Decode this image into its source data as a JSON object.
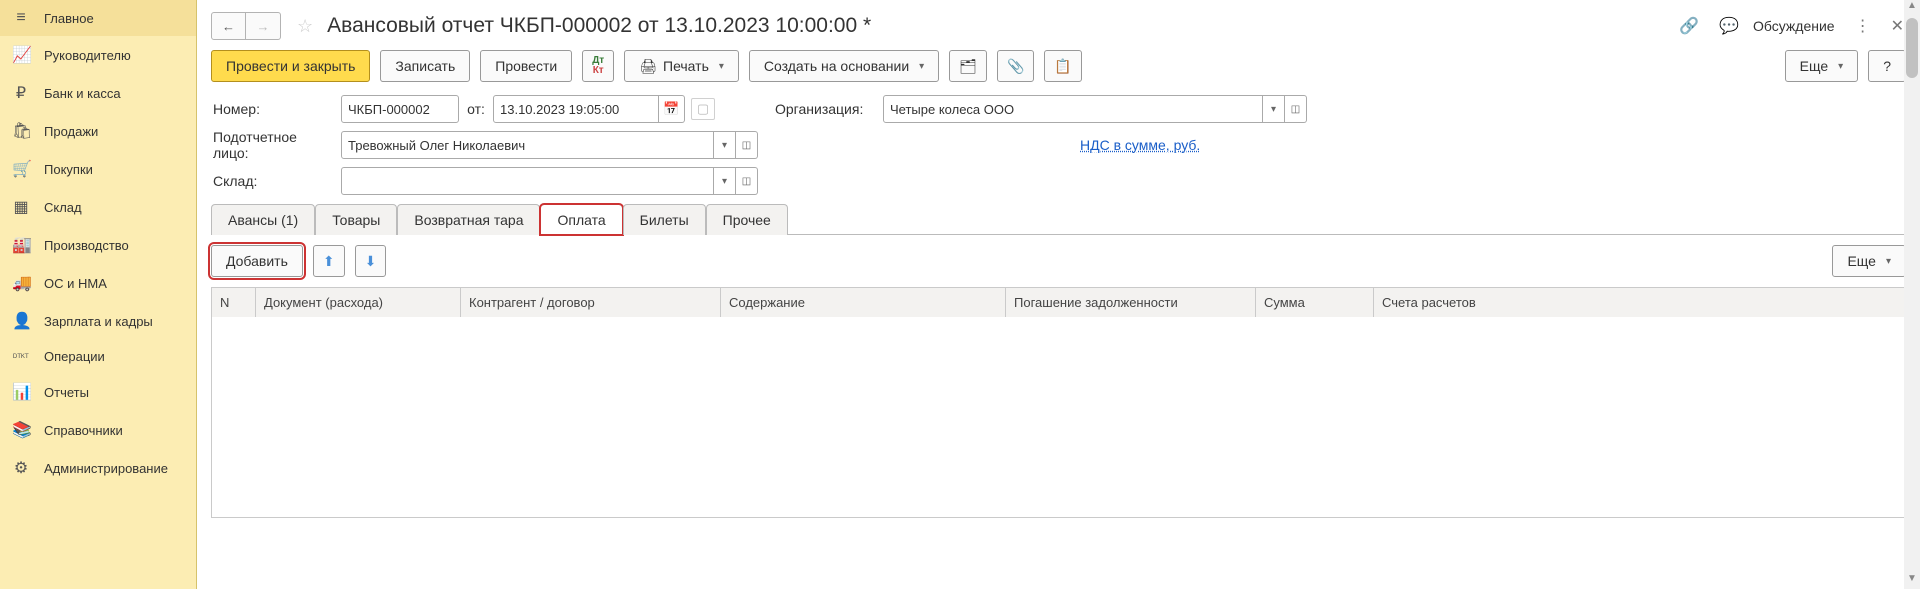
{
  "sidebar": {
    "items": [
      {
        "icon": "≡",
        "label": "Главное"
      },
      {
        "icon": "📈",
        "label": "Руководителю"
      },
      {
        "icon": "₽",
        "label": "Банк и касса"
      },
      {
        "icon": "🛍",
        "label": "Продажи"
      },
      {
        "icon": "🛒",
        "label": "Покупки"
      },
      {
        "icon": "▦",
        "label": "Склад"
      },
      {
        "icon": "🏭",
        "label": "Производство"
      },
      {
        "icon": "🚚",
        "label": "ОС и НМА"
      },
      {
        "icon": "👤",
        "label": "Зарплата и кадры"
      },
      {
        "icon": "ᴰᵀᴷᵀ",
        "label": "Операции"
      },
      {
        "icon": "📊",
        "label": "Отчеты"
      },
      {
        "icon": "📚",
        "label": "Справочники"
      },
      {
        "icon": "⚙",
        "label": "Администрирование"
      }
    ]
  },
  "header": {
    "title": "Авансовый отчет ЧКБП-000002 от 13.10.2023 10:00:00 *",
    "discuss": "Обсуждение"
  },
  "cmd": {
    "post_close": "Провести и закрыть",
    "write": "Записать",
    "post": "Провести",
    "print": "Печать",
    "create_based": "Создать на основании",
    "more": "Еще",
    "help": "?"
  },
  "form": {
    "number_label": "Номер:",
    "number_value": "ЧКБП-000002",
    "from_label": "от:",
    "date_value": "13.10.2023 19:05:00",
    "org_label": "Организация:",
    "org_value": "Четыре колеса ООО",
    "person_label": "Подотчетное лицо:",
    "person_value": "Тревожный Олег Николаевич",
    "nds_link": "НДС в сумме, руб.",
    "warehouse_label": "Склад:",
    "warehouse_value": ""
  },
  "tabs": {
    "advances": "Авансы (1)",
    "goods": "Товары",
    "return_pack": "Возвратная тара",
    "payment": "Оплата",
    "tickets": "Билеты",
    "other": "Прочее"
  },
  "tabtool": {
    "add": "Добавить",
    "more": "Еще"
  },
  "cols": {
    "n": "N",
    "doc": "Документ (расхода)",
    "contr": "Контрагент / договор",
    "content": "Содержание",
    "debt": "Погашение задолженности",
    "sum": "Сумма",
    "acc": "Счета расчетов"
  }
}
